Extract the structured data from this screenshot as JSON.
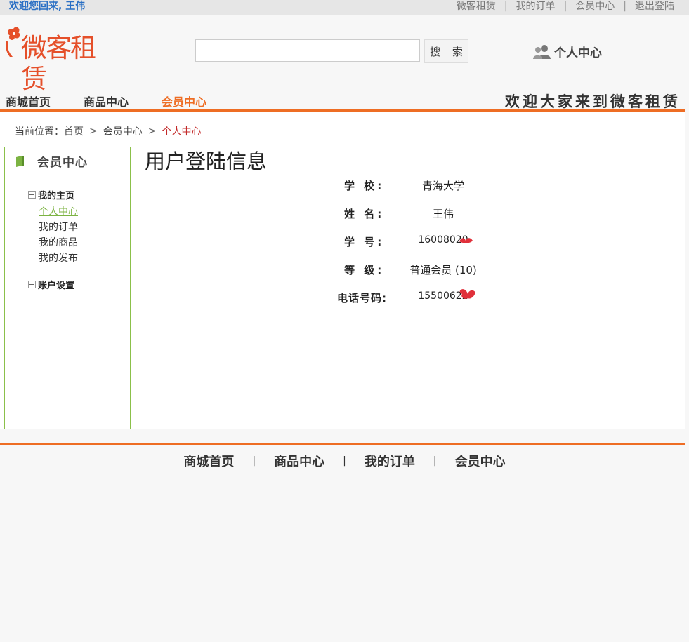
{
  "topbar": {
    "welcome": "欢迎您回来, 王伟",
    "links": [
      "微客租赁",
      "我的订单",
      "会员中心",
      "退出登陆"
    ]
  },
  "header": {
    "logo_text": "微客租赁",
    "search": {
      "value": "",
      "placeholder": "",
      "button_label": "搜 索"
    },
    "personal_center_label": "个人中心"
  },
  "nav": {
    "items": [
      "商城首页",
      "商品中心",
      "会员中心"
    ],
    "active_item": "会员中心",
    "slogan": "欢迎大家来到微客租赁"
  },
  "breadcrumb": {
    "prefix": "当前位置：",
    "items": [
      "首页",
      "会员中心",
      "个人中心"
    ]
  },
  "sidebar": {
    "title": "会员中心",
    "groups": [
      {
        "label": "我的主页",
        "items": [
          "个人中心",
          "我的订单",
          "我的商品",
          "我的发布"
        ]
      },
      {
        "label": "账户设置",
        "items": []
      }
    ],
    "active_item": "个人中心"
  },
  "main": {
    "title": "用户登陆信息",
    "fields": [
      {
        "label": "学 校:",
        "value": "青海大学"
      },
      {
        "label": "姓 名:",
        "value": "王伟"
      },
      {
        "label": "学 号:",
        "value": "16008020"
      },
      {
        "label": "等 级:",
        "value": "普通会员 (10)"
      },
      {
        "label": "电话号码:",
        "value": "15500622"
      }
    ]
  },
  "footer": {
    "links": [
      "商城首页",
      "商品中心",
      "我的订单",
      "会员中心"
    ]
  },
  "colors": {
    "accent_orange": "#ee6d24",
    "sidebar_green": "#8bc04a",
    "welcome_blue": "#2a6fc4",
    "breadcrumb_current": "#c32a2a",
    "redaction_red": "#e0303a"
  }
}
